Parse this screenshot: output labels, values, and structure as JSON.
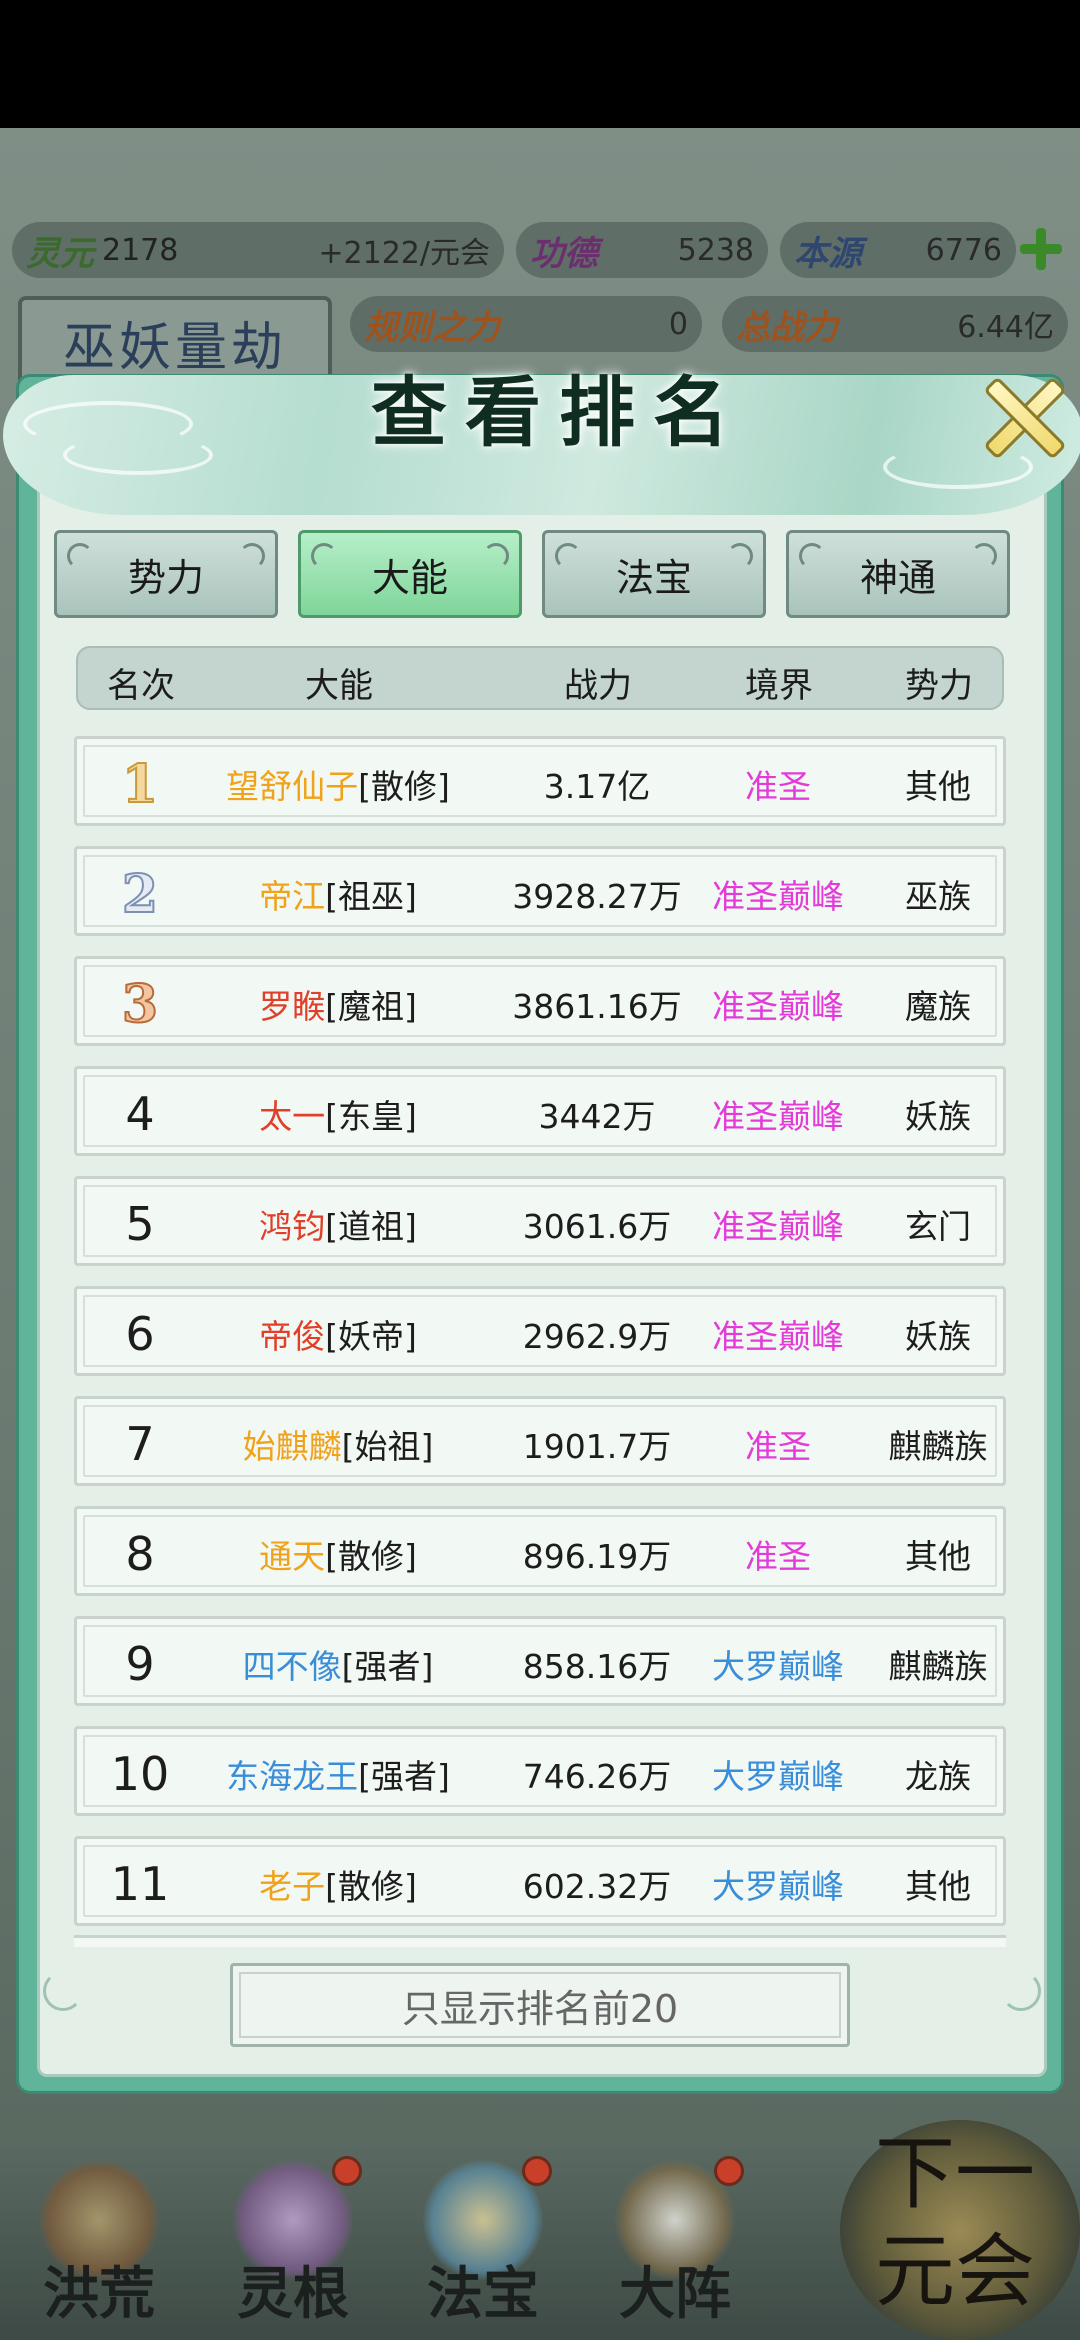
{
  "resources": {
    "lingyuan_label": "灵元",
    "lingyuan_value": "2178",
    "lingyuan_rate": "+2122/元会",
    "gongde_label": "功德",
    "gongde_value": "5238",
    "benyuan_label": "本源",
    "benyuan_value": "6776",
    "guize_label": "规则之力",
    "guize_value": "0",
    "zongzhanli_label": "总战力",
    "zongzhanli_value": "6.44亿"
  },
  "era_name": "巫妖量劫",
  "dialog": {
    "title": "查看排名",
    "tabs": [
      {
        "label": "势力",
        "active": false
      },
      {
        "label": "大能",
        "active": true
      },
      {
        "label": "法宝",
        "active": false
      },
      {
        "label": "神通",
        "active": false
      }
    ],
    "columns": [
      "名次",
      "大能",
      "战力",
      "境界",
      "势力"
    ],
    "rows": [
      {
        "rank": "1",
        "name": "望舒仙子",
        "title": "[散修]",
        "power": "3.17亿",
        "realm": "准圣",
        "faction": "其他"
      },
      {
        "rank": "2",
        "name": "帝江",
        "title": "[祖巫]",
        "power": "3928.27万",
        "realm": "准圣巅峰",
        "faction": "巫族"
      },
      {
        "rank": "3",
        "name": "罗睺",
        "title": "[魔祖]",
        "power": "3861.16万",
        "realm": "准圣巅峰",
        "faction": "魔族"
      },
      {
        "rank": "4",
        "name": "太一",
        "title": "[东皇]",
        "power": "3442万",
        "realm": "准圣巅峰",
        "faction": "妖族"
      },
      {
        "rank": "5",
        "name": "鸿钧",
        "title": "[道祖]",
        "power": "3061.6万",
        "realm": "准圣巅峰",
        "faction": "玄门"
      },
      {
        "rank": "6",
        "name": "帝俊",
        "title": "[妖帝]",
        "power": "2962.9万",
        "realm": "准圣巅峰",
        "faction": "妖族"
      },
      {
        "rank": "7",
        "name": "始麒麟",
        "title": "[始祖]",
        "power": "1901.7万",
        "realm": "准圣",
        "faction": "麒麟族"
      },
      {
        "rank": "8",
        "name": "通天",
        "title": "[散修]",
        "power": "896.19万",
        "realm": "准圣",
        "faction": "其他"
      },
      {
        "rank": "9",
        "name": "四不像",
        "title": "[强者]",
        "power": "858.16万",
        "realm": "大罗巅峰",
        "faction": "麒麟族"
      },
      {
        "rank": "10",
        "name": "东海龙王",
        "title": "[强者]",
        "power": "746.26万",
        "realm": "大罗巅峰",
        "faction": "龙族"
      },
      {
        "rank": "11",
        "name": "老子",
        "title": "[散修]",
        "power": "602.32万",
        "realm": "大罗巅峰",
        "faction": "其他"
      }
    ],
    "filter_button": "只显示排名前20"
  },
  "bottom_nav": [
    {
      "label": "洪荒",
      "badge": false
    },
    {
      "label": "灵根",
      "badge": true
    },
    {
      "label": "法宝",
      "badge": true
    },
    {
      "label": "大阵",
      "badge": true
    }
  ],
  "next_button": "下一元会"
}
